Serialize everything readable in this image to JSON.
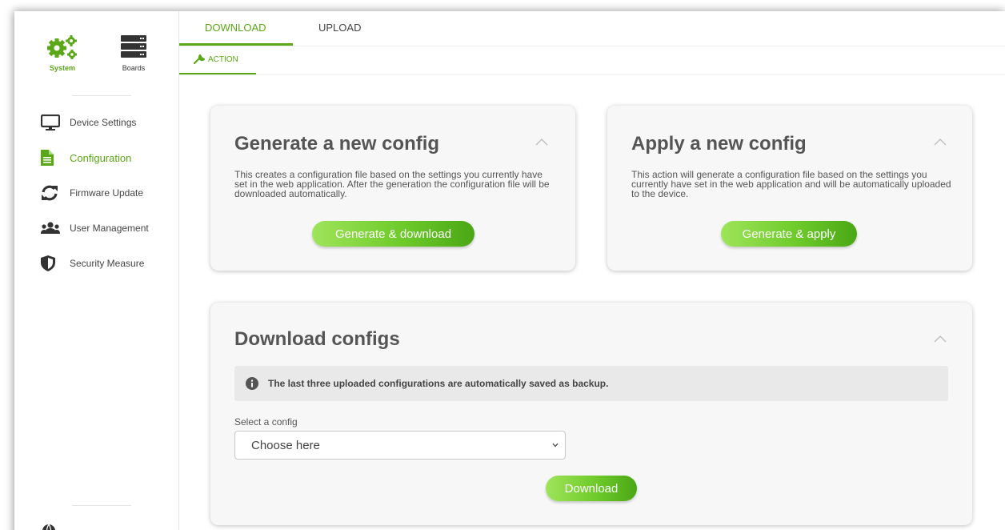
{
  "sidebar": {
    "top": [
      {
        "label": "System",
        "icon": "gears-icon"
      },
      {
        "label": "Boards",
        "icon": "server-icon"
      }
    ],
    "items": [
      {
        "label": "Device Settings",
        "icon": "monitor-icon"
      },
      {
        "label": "Configuration",
        "icon": "file-icon"
      },
      {
        "label": "Firmware Update",
        "icon": "refresh-icon"
      },
      {
        "label": "User Management",
        "icon": "users-icon"
      },
      {
        "label": "Security Measure",
        "icon": "shield-icon"
      }
    ],
    "active_item": "Configuration"
  },
  "tabs": {
    "items": [
      "DOWNLOAD",
      "UPLOAD"
    ],
    "active": "DOWNLOAD",
    "subtab": "ACTION"
  },
  "cards": {
    "generate": {
      "title": "Generate a new config",
      "description": "This creates a configuration file based on the settings you currently have set in the web application. After the generation the configuration file will be downloaded automatically.",
      "button": "Generate & download"
    },
    "apply": {
      "title": "Apply a new config",
      "description": "This action will generate a configuration file based on the settings you currently have set in the web application and will be automatically uploaded to the device.",
      "button": "Generate & apply"
    },
    "download": {
      "title": "Download configs",
      "info": "The last three uploaded configurations are automatically saved as backup.",
      "select_label": "Select a config",
      "select_value": "Choose here",
      "button": "Download"
    }
  },
  "colors": {
    "accent": "#5aa717",
    "card_bg": "#f7f7f7",
    "info_bg": "#e9e9e9"
  }
}
